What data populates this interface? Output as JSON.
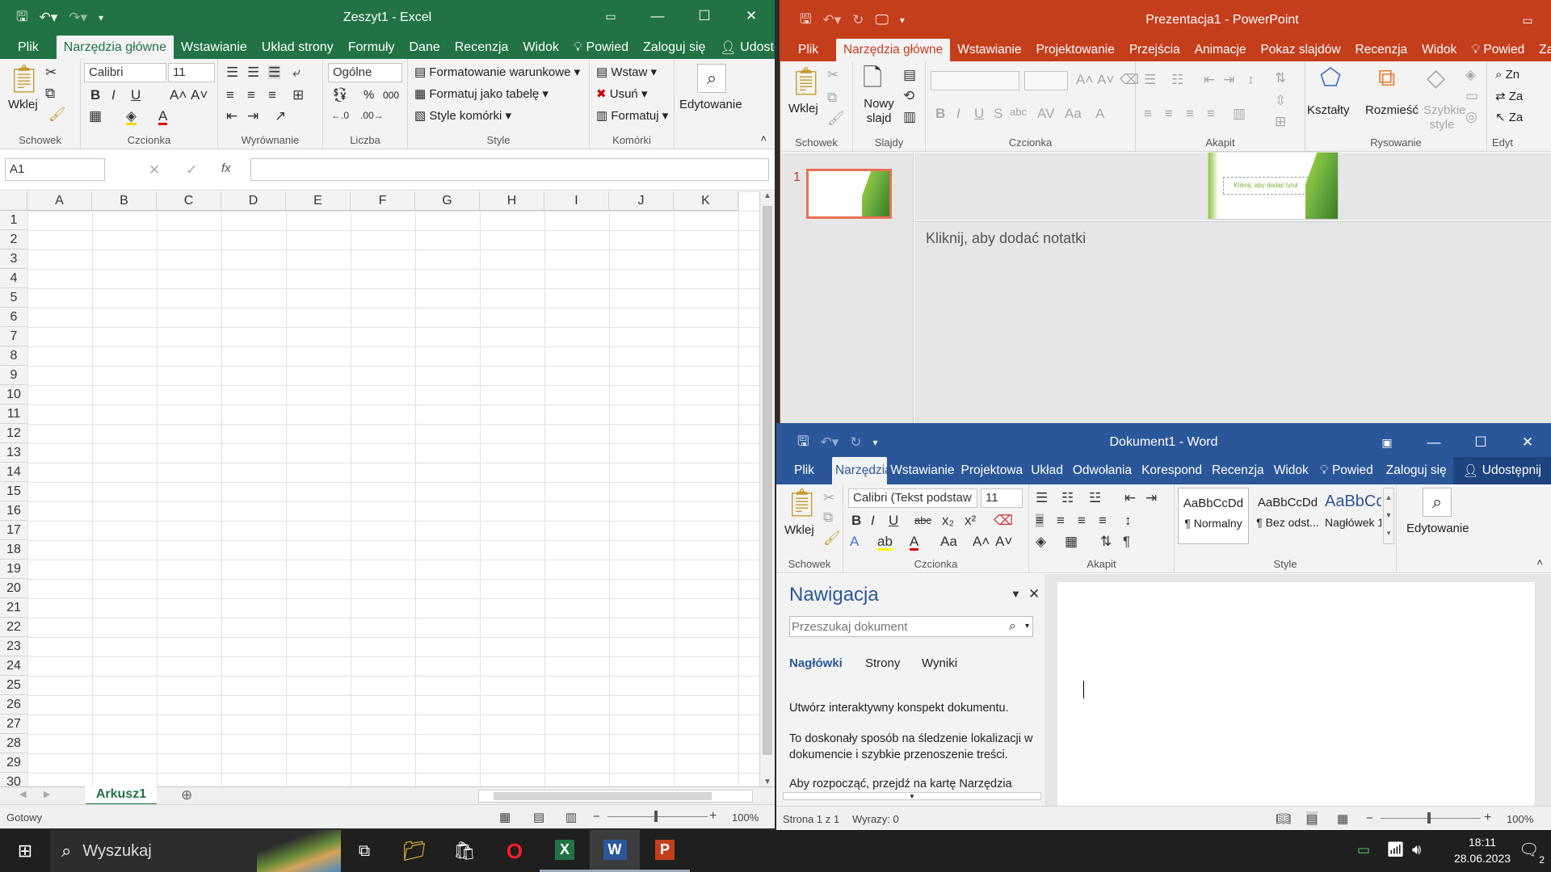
{
  "excel": {
    "title": "Zeszyt1 - Excel",
    "accent": "#217346",
    "tabs": [
      "Plik",
      "Narzędzia główne",
      "Wstawianie",
      "Układ strony",
      "Formuły",
      "Dane",
      "Recenzja",
      "Widok",
      "Powied",
      "Zaloguj się",
      "Udostępnij"
    ],
    "clipboard": {
      "paste": "Wklej",
      "label": "Schowek"
    },
    "font": {
      "name": "Calibri",
      "size": "11",
      "label": "Czcionka"
    },
    "align_label": "Wyrównanie",
    "number": {
      "format": "Ogólne",
      "label": "Liczba",
      "percent": "%",
      "thousands": "000"
    },
    "styles": {
      "cond": "Formatowanie warunkowe",
      "table": "Formatuj jako tabelę",
      "cell": "Style komórki",
      "label": "Style"
    },
    "cells": {
      "insert": "Wstaw",
      "delete": "Usuń",
      "format": "Formatuj",
      "label": "Komórki"
    },
    "editing": "Edytowanie",
    "namebox": "A1",
    "fx": "fx",
    "columns": [
      "A",
      "B",
      "C",
      "D",
      "E",
      "F",
      "G",
      "H",
      "I",
      "J",
      "K"
    ],
    "rows": [
      "1",
      "2",
      "3",
      "4",
      "5",
      "6",
      "7",
      "8",
      "9",
      "10",
      "11",
      "12",
      "13",
      "14",
      "15",
      "16",
      "17",
      "18",
      "19",
      "20",
      "21",
      "22",
      "23",
      "24",
      "25",
      "26",
      "27",
      "28",
      "29",
      "30"
    ],
    "sheet": "Arkusz1",
    "status": "Gotowy",
    "zoom": "100%"
  },
  "powerpoint": {
    "title": "Prezentacja1 - PowerPoint",
    "accent": "#c43e1c",
    "tabs": [
      "Plik",
      "Narzędzia główne",
      "Wstawianie",
      "Projektowanie",
      "Przejścia",
      "Animacje",
      "Pokaz slajdów",
      "Recenzja",
      "Widok",
      "Powied",
      "Zaloguj się"
    ],
    "clipboard": {
      "paste": "Wklej",
      "label": "Schowek"
    },
    "slides": {
      "new": "Nowy slajd",
      "label": "Slajdy"
    },
    "font_label": "Czcionka",
    "para_label": "Akapit",
    "drawing": {
      "shapes": "Kształty",
      "arrange": "Rozmieść",
      "quick": "Szybkie style",
      "label": "Rysowanie"
    },
    "editing_label": "Edyt",
    "editing_items": [
      "Zn",
      "Za",
      "Za"
    ],
    "slide_number": "1",
    "slide_title_placeholder": "Kliknij, aby dodać tytuł",
    "notes": "Kliknij, aby dodać notatki"
  },
  "word": {
    "title": "Dokument1 - Word",
    "accent": "#2b579a",
    "tabs": [
      "Plik",
      "Narzędzia g",
      "Wstawianie",
      "Projektowa",
      "Układ",
      "Odwołania",
      "Korespond",
      "Recenzja",
      "Widok",
      "Powied",
      "Zaloguj się",
      "Udostępnij"
    ],
    "clipboard": {
      "paste": "Wklej",
      "label": "Schowek"
    },
    "font": {
      "name": "Calibri (Tekst podstaw",
      "size": "11",
      "label": "Czcionka"
    },
    "para_label": "Akapit",
    "styles": [
      {
        "preview": "AaBbCcDd",
        "name": "¶ Normalny"
      },
      {
        "preview": "AaBbCcDd",
        "name": "¶ Bez odst..."
      },
      {
        "preview": "AaBbCc",
        "name": "Nagłówek 1"
      }
    ],
    "styles_label": "Style",
    "editing": "Edytowanie",
    "nav": {
      "title": "Nawigacja",
      "search_placeholder": "Przeszukaj dokument",
      "tabs": [
        "Nagłówki",
        "Strony",
        "Wyniki"
      ],
      "p1": "Utwórz interaktywny konspekt dokumentu.",
      "p2": "To doskonały sposób na śledzenie lokalizacji w dokumencie i szybkie przenoszenie treści.",
      "p3": "Aby rozpocząć, przejdź na kartę Narzędzia"
    },
    "status_page": "Strona 1 z 1",
    "status_words": "Wyrazy: 0",
    "zoom": "100%"
  },
  "taskbar": {
    "search": "Wyszukaj",
    "time": "18:11",
    "date": "28.06.2023",
    "notifications": "2"
  }
}
